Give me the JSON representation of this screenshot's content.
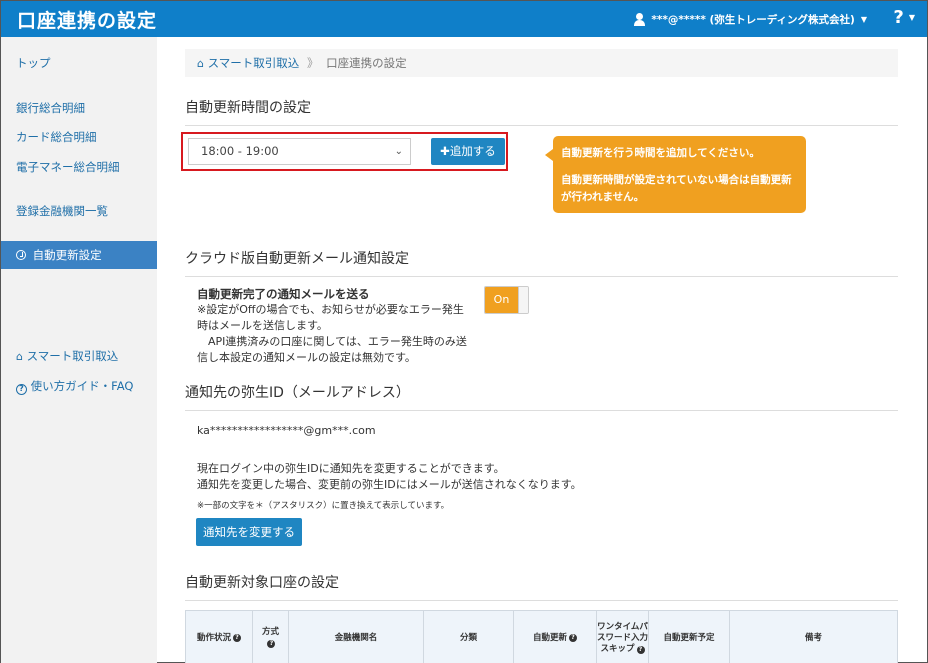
{
  "header": {
    "title": "口座連携の設定",
    "user": "***@***** (弥生トレーディング株式会社)",
    "help": "?"
  },
  "sidebar": {
    "items": [
      {
        "label": "トップ"
      },
      {
        "label": "銀行総合明細"
      },
      {
        "label": "カード総合明細"
      },
      {
        "label": "電子マネー総合明細"
      },
      {
        "label": "登録金融機関一覧"
      },
      {
        "label": "自動更新設定"
      },
      {
        "label": "スマート取引取込"
      },
      {
        "label": "使い方ガイド・FAQ"
      }
    ]
  },
  "breadcrumb": {
    "home": "スマート取引取込",
    "separator": "》",
    "current": "口座連携の設定"
  },
  "auto_update_time": {
    "title": "自動更新時間の設定",
    "selected": "18:00 - 19:00",
    "add_label": "追加する",
    "tooltip_line1": "自動更新を行う時間を追加してください。",
    "tooltip_line2": "自動更新時間が設定されていない場合は自動更新が行われません。"
  },
  "notify": {
    "title": "クラウド版自動更新メール通知設定",
    "label": "自動更新完了の通知メールを送る",
    "body1": "※設定がOffの場合でも、お知らせが必要なエラー発生時はメールを送信します。",
    "body2": "　API連携済みの口座に関しては、エラー発生時のみ送信し本設定の通知メールの設定は無効です。",
    "toggle": "On"
  },
  "recipient": {
    "title": "通知先の弥生ID（メールアドレス）",
    "email": "ka*****************@gm***.com",
    "desc1": "現在ログイン中の弥生IDに通知先を変更することができます。",
    "desc2": "通知先を変更した場合、変更前の弥生IDにはメールが送信されなくなります。",
    "note": "※一部の文字を＊（アスタリスク）に置き換えて表示しています。",
    "change_label": "通知先を変更する"
  },
  "accounts": {
    "title": "自動更新対象口座の設定",
    "columns": [
      "動作状況",
      "方式",
      "金融機関名",
      "分類",
      "自動更新",
      "ワンタイムパスワード入力スキップ",
      "自動更新予定",
      "備考"
    ]
  },
  "colors": {
    "header": "#0f7fc9",
    "accent": "#1f86c2",
    "tooltip": "#f0a020",
    "highlight_border": "#d7191f"
  }
}
